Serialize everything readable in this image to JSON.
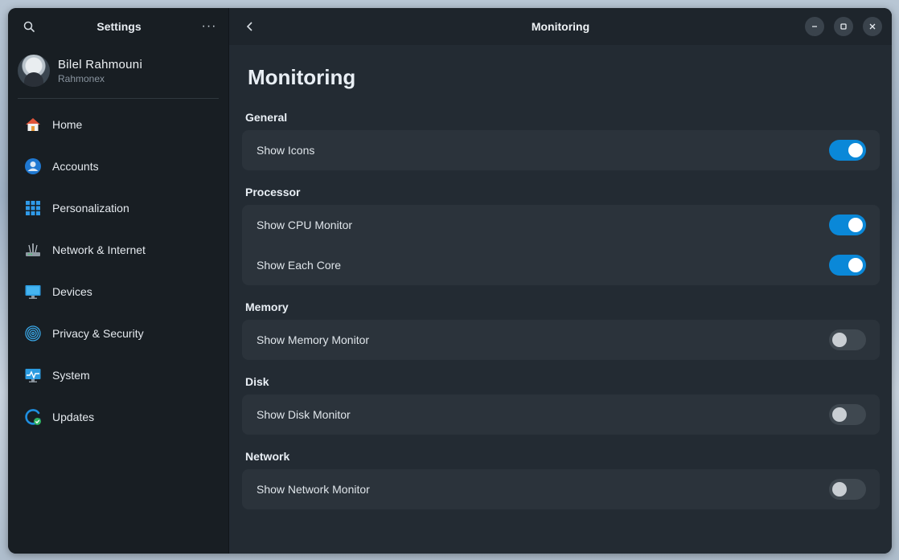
{
  "sidebar": {
    "title": "Settings",
    "more_label": "···",
    "user": {
      "name": "Bilel Rahmouni",
      "username": "Rahmonex"
    },
    "items": [
      {
        "label": "Home",
        "icon": "home-icon"
      },
      {
        "label": "Accounts",
        "icon": "accounts-icon"
      },
      {
        "label": "Personalization",
        "icon": "personalization-icon"
      },
      {
        "label": "Network & Internet",
        "icon": "network-icon"
      },
      {
        "label": "Devices",
        "icon": "devices-icon"
      },
      {
        "label": "Privacy & Security",
        "icon": "fingerprint-icon"
      },
      {
        "label": "System",
        "icon": "system-icon"
      },
      {
        "label": "Updates",
        "icon": "updates-icon"
      }
    ]
  },
  "header": {
    "title": "Monitoring"
  },
  "page": {
    "title": "Monitoring",
    "sections": [
      {
        "label": "General",
        "rows": [
          {
            "label": "Show Icons",
            "enabled": true
          }
        ]
      },
      {
        "label": "Processor",
        "rows": [
          {
            "label": "Show CPU Monitor",
            "enabled": true
          },
          {
            "label": "Show Each Core",
            "enabled": true
          }
        ]
      },
      {
        "label": "Memory",
        "rows": [
          {
            "label": "Show Memory Monitor",
            "enabled": false
          }
        ]
      },
      {
        "label": "Disk",
        "rows": [
          {
            "label": "Show Disk Monitor",
            "enabled": false
          }
        ]
      },
      {
        "label": "Network",
        "rows": [
          {
            "label": "Show Network Monitor",
            "enabled": false
          }
        ]
      }
    ]
  },
  "colors": {
    "accent": "#0a88d8",
    "sidebar_bg": "#181e23",
    "main_bg": "#232b33",
    "card_bg": "#2b333b"
  }
}
